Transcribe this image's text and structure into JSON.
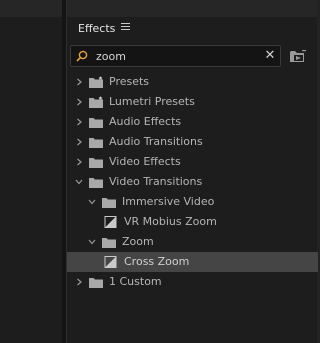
{
  "panel": {
    "title": "Effects"
  },
  "search": {
    "value": "zoom",
    "placeholder": ""
  },
  "tree": [
    {
      "label": "Presets",
      "depth": 0,
      "kind": "star-folder",
      "expanded": false
    },
    {
      "label": "Lumetri Presets",
      "depth": 0,
      "kind": "star-folder",
      "expanded": false
    },
    {
      "label": "Audio Effects",
      "depth": 0,
      "kind": "folder",
      "expanded": false
    },
    {
      "label": "Audio Transitions",
      "depth": 0,
      "kind": "folder",
      "expanded": false
    },
    {
      "label": "Video Effects",
      "depth": 0,
      "kind": "folder",
      "expanded": false
    },
    {
      "label": "Video Transitions",
      "depth": 0,
      "kind": "folder",
      "expanded": true
    },
    {
      "label": "Immersive Video",
      "depth": 1,
      "kind": "folder",
      "expanded": true
    },
    {
      "label": "VR Mobius Zoom",
      "depth": 2,
      "kind": "transition"
    },
    {
      "label": "Zoom",
      "depth": 1,
      "kind": "folder",
      "expanded": true
    },
    {
      "label": "Cross Zoom",
      "depth": 2,
      "kind": "transition",
      "selected": true
    },
    {
      "label": "1 Custom",
      "depth": 0,
      "kind": "folder",
      "expanded": false
    }
  ],
  "colors": {
    "background": "#1d1d1d",
    "selected_row": "#454545",
    "search_icon": "#e8a23c"
  }
}
